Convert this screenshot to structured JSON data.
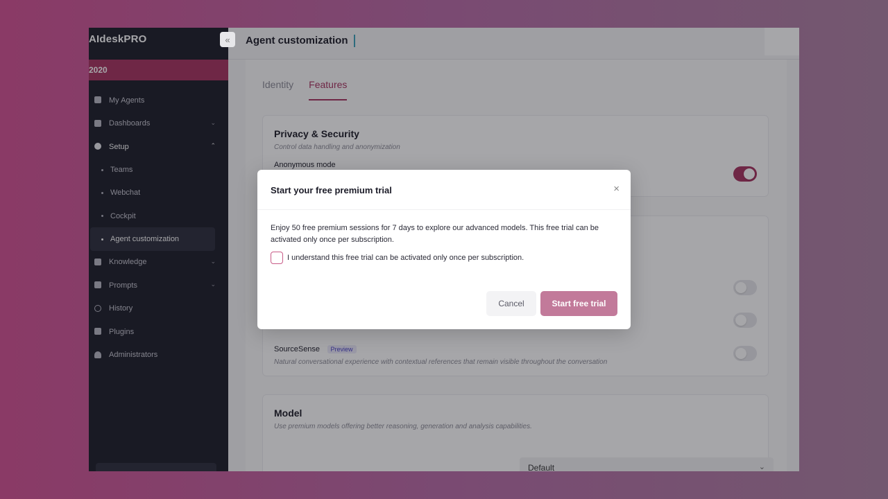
{
  "app": {
    "logo": "AIdeskPRO",
    "org": "2020",
    "collapse_glyph": "«"
  },
  "sidebar": {
    "items": [
      {
        "label": "My Agents",
        "icon": "agents-icon"
      },
      {
        "label": "Dashboards",
        "icon": "dashboard-icon",
        "chevron": "⌄"
      },
      {
        "label": "Setup",
        "icon": "gear-icon",
        "chevron": "⌃"
      }
    ],
    "setup_children": [
      {
        "label": "Teams"
      },
      {
        "label": "Webchat"
      },
      {
        "label": "Cockpit"
      },
      {
        "label": "Agent customization"
      }
    ],
    "items_after": [
      {
        "label": "Knowledge",
        "icon": "document-icon",
        "chevron": "⌄"
      },
      {
        "label": "Prompts",
        "icon": "prompt-icon",
        "chevron": "⌄"
      },
      {
        "label": "History",
        "icon": "history-icon"
      },
      {
        "label": "Plugins",
        "icon": "plugin-icon"
      },
      {
        "label": "Administrators",
        "icon": "admin-icon"
      }
    ]
  },
  "header": {
    "title": "Agent customization"
  },
  "tabs": [
    {
      "label": "Identity",
      "active": false
    },
    {
      "label": "Features",
      "active": true
    }
  ],
  "privacy_card": {
    "title": "Privacy & Security",
    "subtitle": "Control data handling and anonymization",
    "anon_label": "Anonymous mode",
    "anon_on": true
  },
  "features_card": {
    "sourcesense_label": "SourceSense",
    "preview_badge": "Preview",
    "sourcesense_desc": "Natural conversational experience with contextual references that remain visible throughout the conversation"
  },
  "model_card": {
    "title": "Model",
    "subtitle": "Use premium models offering better reasoning, generation and analysis capabilities.",
    "select_value": "Default"
  },
  "modal": {
    "title": "Start your free premium trial",
    "close_glyph": "×",
    "body": "Enjoy 50 free premium sessions for 7 days to explore our advanced models. This free trial can be activated only once per subscription.",
    "checkbox_label": "I understand this free trial can be activated only once per subscription.",
    "cancel_label": "Cancel",
    "start_label": "Start free trial"
  },
  "colors": {
    "brand": "#a7325f",
    "sidebar_bg": "#1c1d29",
    "primary_button_disabled": "#c27a9a"
  }
}
